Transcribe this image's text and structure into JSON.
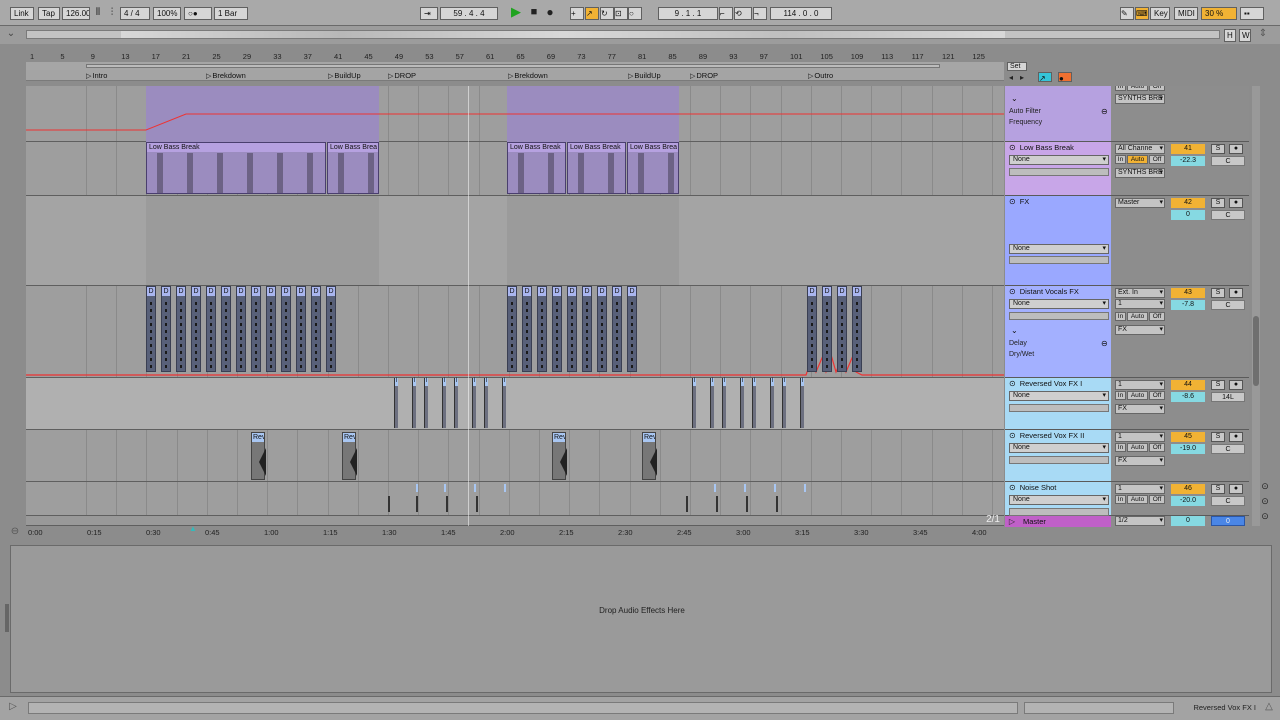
{
  "toolbar": {
    "link": "Link",
    "tap": "Tap",
    "tempo": "126.00",
    "signature": "4 / 4",
    "zoom": "100%",
    "record_indicator": "○●",
    "quantization": "1 Bar",
    "position": "59 .  4 .  4",
    "loop_start": "9 .  1 .  1",
    "loop_length": "114 .  0 .  0",
    "key": "Key",
    "midi": "MIDI",
    "cpu": "30 %",
    "overview_h": "H",
    "overview_w": "W"
  },
  "ruler": {
    "bars": [
      "1",
      "5",
      "9",
      "13",
      "17",
      "21",
      "25",
      "29",
      "33",
      "37",
      "41",
      "45",
      "49",
      "53",
      "57",
      "61",
      "65",
      "69",
      "73",
      "77",
      "81",
      "85",
      "89",
      "93",
      "97",
      "101",
      "105",
      "109",
      "113",
      "117",
      "121",
      "125"
    ]
  },
  "locators": [
    {
      "label": "Intro"
    },
    {
      "label": "Brekdown"
    },
    {
      "label": "BuildUp"
    },
    {
      "label": "DROP"
    },
    {
      "label": "Brekdown"
    },
    {
      "label": "BuildUp"
    },
    {
      "label": "DROP"
    },
    {
      "label": "Outro"
    }
  ],
  "clips": {
    "bass": [
      "Low Bass Break",
      "Low Bass Brea",
      "Low Bass Break",
      "Low Bass Break",
      "Low Bass Brea"
    ],
    "vox_label": "D",
    "reversed_label": "I",
    "rev_label": "Rev"
  },
  "timeline": [
    "0:00",
    "0:15",
    "0:30",
    "0:45",
    "1:00",
    "1:15",
    "1:30",
    "1:45",
    "2:00",
    "2:15",
    "2:30",
    "2:45",
    "3:00",
    "3:15",
    "3:30",
    "3:45",
    "4:00"
  ],
  "page_indicator": "2/1",
  "set_label": "Set",
  "tracks": [
    {
      "name": "",
      "device": "",
      "auto1": "Auto Filter",
      "auto2": "Frequency",
      "io": "SYNTHS BRE",
      "num": "",
      "vol": "",
      "pan": "",
      "color": "#b6a1e0",
      "monitor": [
        "In",
        "Auto",
        "Off"
      ]
    },
    {
      "name": "Low Bass Break",
      "device": "None",
      "io_in": "All Channe",
      "io": "SYNTHS BRE",
      "num": "41",
      "vol": "-22.3",
      "pan": "C",
      "color": "#c8a6e8",
      "monitor": [
        "In",
        "Auto",
        "Off"
      ]
    },
    {
      "name": "FX",
      "device": "None",
      "io": "Master",
      "num": "42",
      "vol": "0",
      "pan": "C",
      "color": "#9aa8ff"
    },
    {
      "name": "Distant Vocals FX",
      "device": "None",
      "io_in": "Ext. In",
      "io_ch": "1",
      "io": "FX",
      "num": "43",
      "vol": "-7.8",
      "pan": "C",
      "auto1": "Delay",
      "auto2": "Dry/Wet",
      "color": "#a3b0ff",
      "monitor": [
        "In",
        "Auto",
        "Off"
      ]
    },
    {
      "name": "Reversed Vox FX I",
      "device": "None",
      "io_in": "1",
      "io": "FX",
      "num": "44",
      "vol": "-8.6",
      "pan": "14L",
      "color": "#a8daf5",
      "monitor": [
        "In",
        "Auto",
        "Off"
      ]
    },
    {
      "name": "Reversed Vox FX II",
      "device": "None",
      "io_in": "1",
      "io": "FX",
      "num": "45",
      "vol": "-19.0",
      "pan": "C",
      "color": "#a8daf5",
      "monitor": [
        "In",
        "Auto",
        "Off"
      ]
    },
    {
      "name": "Noise Shot",
      "device": "None",
      "io_in": "1",
      "io": "",
      "num": "46",
      "vol": "-20.0",
      "pan": "C",
      "color": "#a8daf5",
      "monitor": [
        "In",
        "Auto",
        "Off"
      ]
    }
  ],
  "master": {
    "name": "Master",
    "io": "1/2",
    "vol": "0",
    "pan": "0"
  },
  "solo": "S",
  "detail": {
    "drop_text": "Drop Audio Effects Here"
  },
  "status": {
    "selected_track": "Reversed Vox FX I"
  },
  "colors": {
    "bass_clip": "#b6a1e0",
    "vocal_clip": "#aab6f0",
    "rev_clip": "#a8c6f2",
    "tempo_orange": "#f1b234",
    "volume_cyan": "#86d9e2",
    "master": "#c060c8"
  }
}
